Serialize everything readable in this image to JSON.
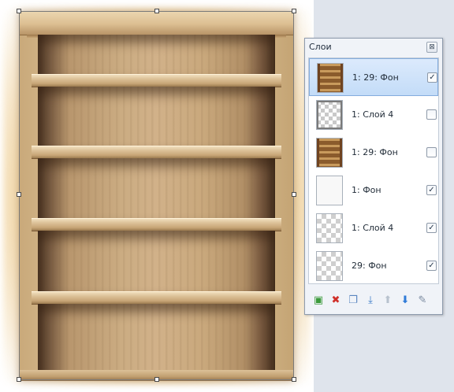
{
  "panel": {
    "title": "Слои",
    "close_glyph": "⊠",
    "close_icon": "close-icon"
  },
  "layers": [
    {
      "name": "1: 29: Фон",
      "thumbnail": "shelf",
      "visible": true,
      "selected": true
    },
    {
      "name": "1: Слой 4",
      "thumbnail": "mixed",
      "visible": false,
      "selected": false
    },
    {
      "name": "1: 29: Фон",
      "thumbnail": "shelf",
      "visible": false,
      "selected": false
    },
    {
      "name": "1: Фон",
      "thumbnail": "blank",
      "visible": true,
      "selected": false
    },
    {
      "name": "1: Слой 4",
      "thumbnail": "checker",
      "visible": true,
      "selected": false
    },
    {
      "name": "29: Фон",
      "thumbnail": "checker",
      "visible": true,
      "selected": false
    }
  ],
  "check_glyph": "✓",
  "toolbar": [
    {
      "icon": "add-layer-icon",
      "glyph": "▣",
      "color": "#3a9a3a"
    },
    {
      "icon": "delete-layer-icon",
      "glyph": "✖",
      "color": "#d0302a"
    },
    {
      "icon": "duplicate-layer-icon",
      "glyph": "❐",
      "color": "#5a86c0"
    },
    {
      "icon": "merge-down-icon",
      "glyph": "⤓",
      "color": "#3c7cc8"
    },
    {
      "icon": "move-up-icon",
      "glyph": "⬆",
      "color": "#b8c2ce"
    },
    {
      "icon": "move-down-icon",
      "glyph": "⬇",
      "color": "#2f7bd8"
    },
    {
      "icon": "layer-properties-icon",
      "glyph": "✎",
      "color": "#7a8aa0"
    }
  ],
  "colors": {
    "panel_background": "#f0f3f8",
    "selected_row": "#c3dcf8",
    "canvas_background": "#ffffff",
    "wood": "#cfb083"
  }
}
